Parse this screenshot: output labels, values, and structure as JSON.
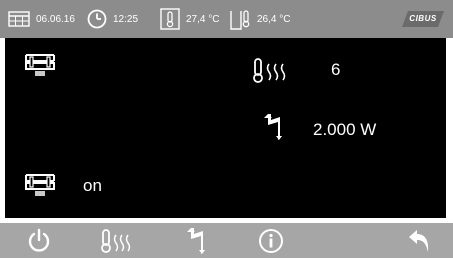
{
  "status_bar": {
    "date": "06.06.16",
    "time": "12:25",
    "indoor_temp": "27,4 °C",
    "outdoor_temp": "26,4 °C",
    "logo_text": "CIBUS"
  },
  "main": {
    "heating_level": "6",
    "power": "2.000 W",
    "heater_state": "on"
  },
  "bottom_nav": {
    "items": [
      {
        "icon": "power-icon"
      },
      {
        "icon": "thermometer-heat-icon"
      },
      {
        "icon": "lightning-icon"
      },
      {
        "icon": "info-icon"
      },
      {
        "icon": "back-arrow-icon"
      }
    ]
  },
  "colors": {
    "status_bar_bg": "#8c8c8c",
    "main_bg": "#000000",
    "bottom_bar_bg": "#a6a6a6",
    "foreground": "#ffffff"
  }
}
